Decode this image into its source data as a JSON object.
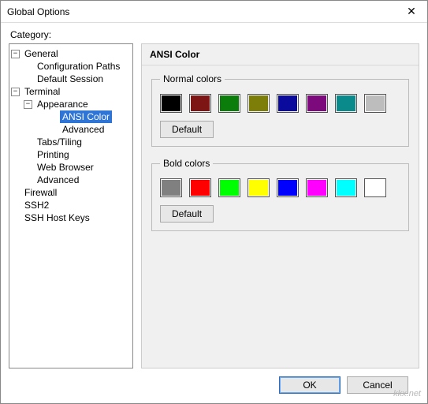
{
  "window": {
    "title": "Global Options"
  },
  "category_label": "Category:",
  "tree": {
    "general": "General",
    "general_children": {
      "config_paths": "Configuration Paths",
      "default_session": "Default Session"
    },
    "terminal": "Terminal",
    "appearance": "Appearance",
    "appearance_children": {
      "ansi_color": "ANSI Color",
      "advanced": "Advanced"
    },
    "terminal_children": {
      "tabs": "Tabs/Tiling",
      "printing": "Printing",
      "web_browser": "Web Browser",
      "advanced": "Advanced"
    },
    "firewall": "Firewall",
    "ssh2": "SSH2",
    "ssh_host_keys": "SSH Host Keys"
  },
  "panel": {
    "title": "ANSI Color",
    "normal_group": "Normal colors",
    "bold_group": "Bold colors",
    "default_button": "Default",
    "normal_colors": [
      "#000000",
      "#7d1515",
      "#0a7d0a",
      "#7d7d0a",
      "#0a0a9c",
      "#7d0a7d",
      "#0a8a8a",
      "#bdbdbd"
    ],
    "bold_colors": [
      "#808080",
      "#ff0000",
      "#00ff00",
      "#ffff00",
      "#0000ff",
      "#ff00ff",
      "#00ffff",
      "#ffffff"
    ]
  },
  "footer": {
    "ok": "OK",
    "cancel": "Cancel"
  },
  "watermark": "kkx.net",
  "icons": {
    "close": "✕",
    "minus": "−",
    "plus": "+"
  }
}
